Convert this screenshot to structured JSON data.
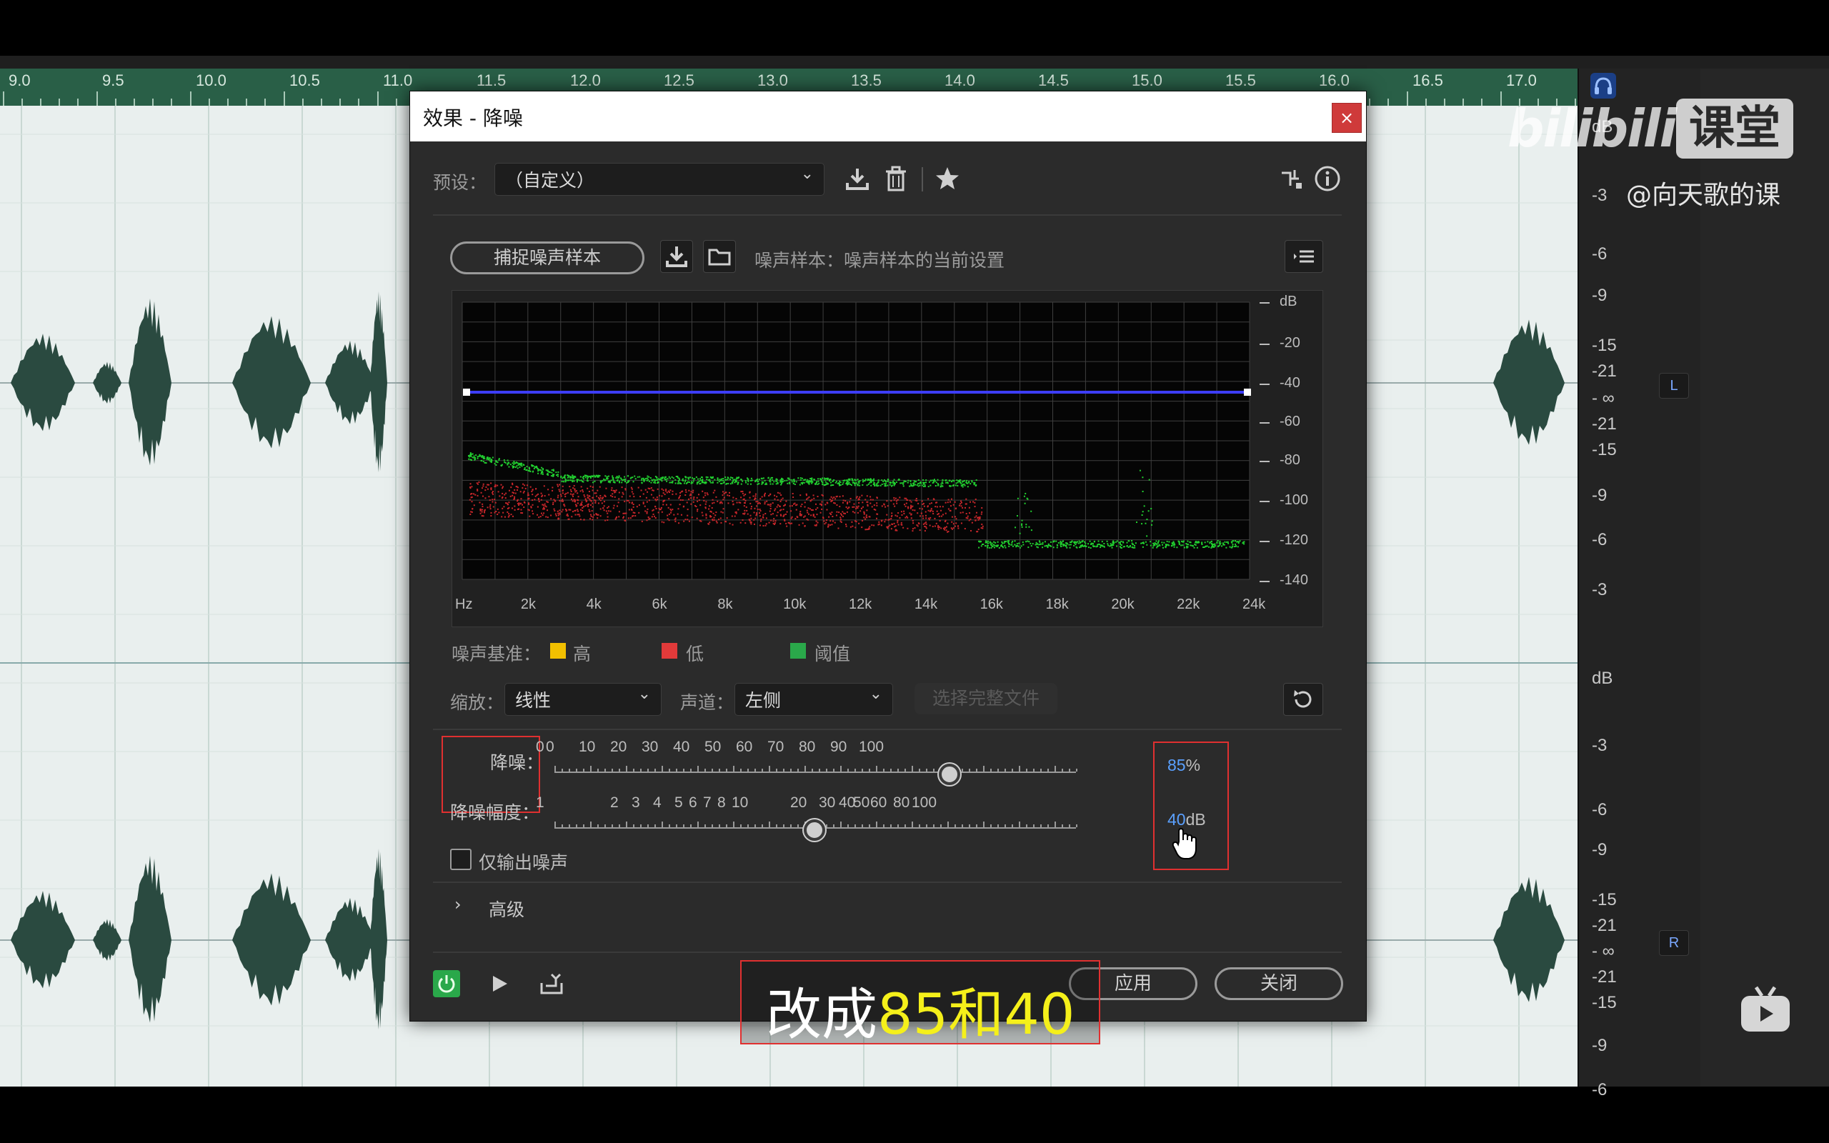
{
  "timeline": {
    "ruler_labels": [
      "9.0",
      "9.5",
      "10.0",
      "10.5",
      "11.0",
      "11.5",
      "12.0",
      "12.5",
      "13.0",
      "13.5",
      "14.0",
      "14.5",
      "15.0",
      "15.5",
      "16.0",
      "16.5",
      "17.0"
    ],
    "meter_top_labels": [
      "dB",
      "-3",
      "-6",
      "-9",
      "-15",
      "-21",
      "- ∞",
      "-21",
      "-15",
      "-9",
      "-6",
      "-3"
    ],
    "meter_bottom_labels": [
      "dB",
      "-3",
      "-6",
      "-9",
      "-15",
      "-21",
      "- ∞",
      "-21",
      "-15",
      "-9",
      "-6"
    ],
    "channel_left": "L",
    "channel_right": "R"
  },
  "dialog": {
    "title": "效果 - 降噪",
    "close_label": "×",
    "preset_label": "预设：",
    "preset_value": "（自定义）",
    "capture_label": "捕捉噪声样本",
    "noise_sample_label": "噪声样本：噪声样本的当前设置",
    "graph": {
      "x_labels": [
        "Hz",
        "2k",
        "4k",
        "6k",
        "8k",
        "10k",
        "12k",
        "14k",
        "16k",
        "18k",
        "20k",
        "22k",
        "24k"
      ],
      "y_labels": [
        "dB",
        "-20",
        "-40",
        "-60",
        "-80",
        "-100",
        "-120",
        "-140"
      ]
    },
    "legend": {
      "label": "噪声基准：",
      "items": [
        {
          "name": "高",
          "color": "#f2c000"
        },
        {
          "name": "低",
          "color": "#e23a3a"
        },
        {
          "name": "阈值",
          "color": "#2aa84a"
        }
      ]
    },
    "scale_label": "缩放：",
    "scale_value": "线性",
    "channel_label": "声道：",
    "channel_value": "左侧",
    "select_file_label": "选择完整文件",
    "reduction": {
      "label": "降噪：",
      "ticks": [
        "0",
        "0",
        "10",
        "20",
        "30",
        "40",
        "50",
        "60",
        "70",
        "80",
        "90",
        "100"
      ],
      "value": 85,
      "value_text": "85",
      "unit": "%"
    },
    "amount": {
      "label": "降噪幅度：",
      "ticks": [
        "1",
        "2",
        "3",
        "4",
        "5",
        "6",
        "7",
        "8",
        "10",
        "20",
        "30",
        "40",
        "50",
        "60",
        "80",
        "100"
      ],
      "value": 40,
      "value_text": "40",
      "unit": "dB"
    },
    "output_noise_only_label": "仅输出噪声",
    "advanced_label": "高级",
    "apply_label": "应用",
    "close_button_label": "关闭"
  },
  "subtitle": {
    "part1": "改成",
    "part2": "85和40"
  },
  "watermark": {
    "logo_text": "bilibili",
    "brand": "课堂",
    "handle": "@向天歌的课"
  },
  "colors": {
    "ruler": "#295f47",
    "waveform": "#2a4a40",
    "threshold_line": "#3d3dff",
    "high_dots": "#22d030",
    "low_dots": "#c8262a",
    "value_blue": "#5aa0ff",
    "subtitle_white": "#ffffff",
    "subtitle_yellow": "#f5f01a"
  }
}
